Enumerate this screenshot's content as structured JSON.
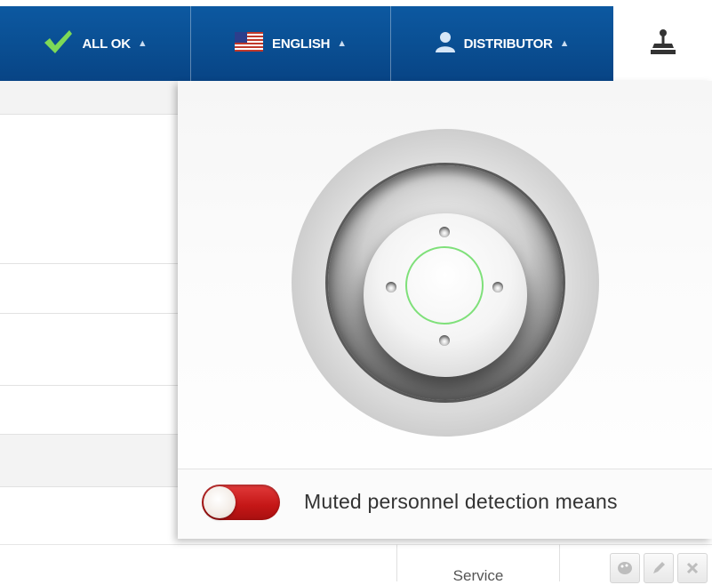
{
  "topbar": {
    "status": {
      "label": "ALL OK",
      "icon": "checkmark-icon",
      "color": "#7ed957"
    },
    "language": {
      "label": "ENGLISH",
      "icon": "us-flag-icon"
    },
    "user": {
      "label": "DISTRIBUTOR",
      "icon": "user-icon"
    },
    "tools": {
      "icon": "joystick-icon"
    },
    "caret": "▲"
  },
  "joystick": {
    "indicator_color": "#7fe07a"
  },
  "popup": {
    "toggle": {
      "state": "off",
      "color": "#c41616"
    },
    "toggle_label": "Muted personnel detection means"
  },
  "table": {
    "role_cell": "Service",
    "actions": [
      "palette-icon",
      "edit-icon",
      "close-icon"
    ]
  }
}
